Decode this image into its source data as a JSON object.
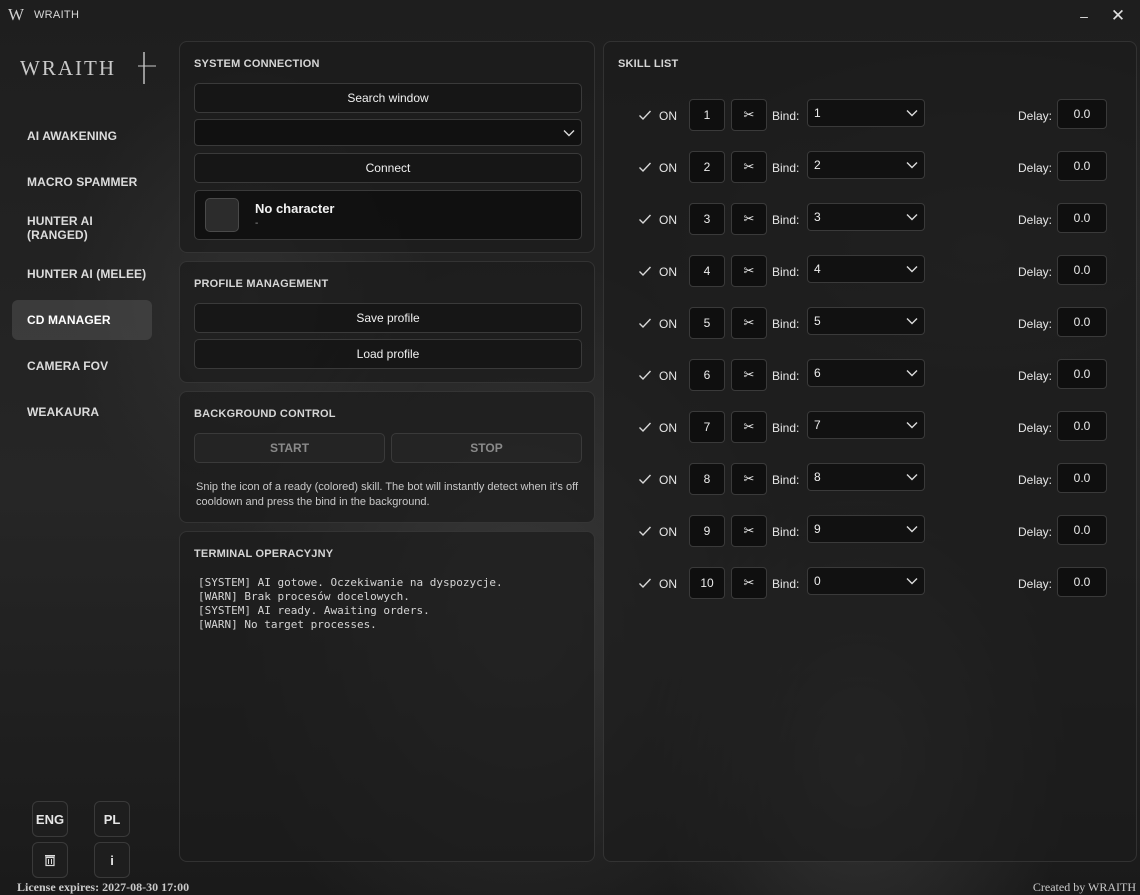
{
  "window": {
    "icon_letter": "W",
    "title": "WRAITH",
    "minimize": "–",
    "close": "✕"
  },
  "sidebar": {
    "logo": "WRAITH",
    "items": [
      {
        "label": "AI AWAKENING"
      },
      {
        "label": "MACRO SPAMMER"
      },
      {
        "label": "HUNTER AI (RANGED)"
      },
      {
        "label": "HUNTER AI (MELEE)"
      },
      {
        "label": "CD MANAGER",
        "active": true
      },
      {
        "label": "CAMERA FOV"
      },
      {
        "label": "WEAKAURA"
      }
    ],
    "lang_eng": "ENG",
    "lang_pl": "PL",
    "info": "i",
    "trash_icon": "trash-icon"
  },
  "system": {
    "title": "SYSTEM CONNECTION",
    "search_window": "Search window",
    "window_select_value": "",
    "connect": "Connect",
    "character_name": "No character",
    "character_sub": "-"
  },
  "profile": {
    "title": "PROFILE MANAGEMENT",
    "save": "Save profile",
    "load": "Load profile"
  },
  "background": {
    "title": "BACKGROUND CONTROL",
    "start": "START",
    "stop": "STOP",
    "hint": "Snip the icon of a ready (colored) skill. The bot will instantly detect when it's off cooldown and press the bind in the background."
  },
  "terminal": {
    "title": "TERMINAL OPERACYJNY",
    "lines": "[SYSTEM] AI gotowe. Oczekiwanie na dyspozycje.\n[WARN] Brak procesów docelowych.\n[SYSTEM] AI ready. Awaiting orders.\n[WARN] No target processes."
  },
  "skills": {
    "title": "SKILL LIST",
    "on_label": "ON",
    "bind_label": "Bind:",
    "delay_label": "Delay:",
    "snip_icon": "scissors-icon",
    "rows": [
      {
        "num": "1",
        "bind": "1",
        "delay": "0.0",
        "on": true
      },
      {
        "num": "2",
        "bind": "2",
        "delay": "0.0",
        "on": true
      },
      {
        "num": "3",
        "bind": "3",
        "delay": "0.0",
        "on": true
      },
      {
        "num": "4",
        "bind": "4",
        "delay": "0.0",
        "on": true
      },
      {
        "num": "5",
        "bind": "5",
        "delay": "0.0",
        "on": true
      },
      {
        "num": "6",
        "bind": "6",
        "delay": "0.0",
        "on": true
      },
      {
        "num": "7",
        "bind": "7",
        "delay": "0.0",
        "on": true
      },
      {
        "num": "8",
        "bind": "8",
        "delay": "0.0",
        "on": true
      },
      {
        "num": "9",
        "bind": "9",
        "delay": "0.0",
        "on": true
      },
      {
        "num": "10",
        "bind": "0",
        "delay": "0.0",
        "on": true
      }
    ]
  },
  "footer": {
    "license": "License expires: 2027-08-30 17:00",
    "created_by": "Created by WRAITH"
  }
}
